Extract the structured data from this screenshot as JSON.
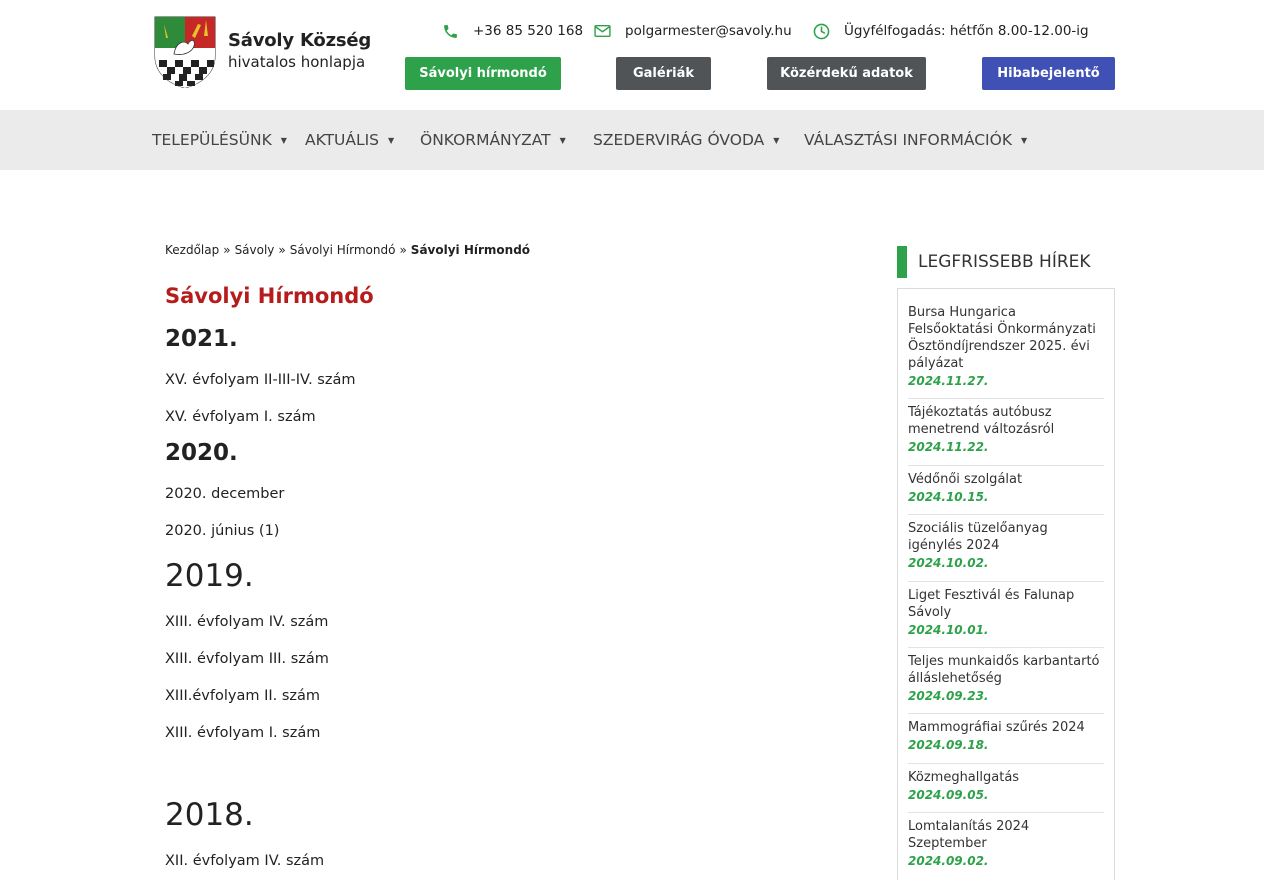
{
  "site": {
    "name": "Sávoly Község",
    "subtitle": "hivatalos honlapja"
  },
  "contact": {
    "phone": "+36 85 520 168",
    "email": "polgarmester@savoly.hu",
    "hours": "Ügyfélfogadás: hétfőn 8.00-12.00-ig"
  },
  "header_buttons": [
    {
      "label": "Sávolyi hírmondó",
      "color": "#2ea24a"
    },
    {
      "label": "Galériák",
      "color": "#515457"
    },
    {
      "label": "Közérdekű adatok",
      "color": "#515457"
    },
    {
      "label": "Hibabejelentő",
      "color": "#3f51b5"
    }
  ],
  "nav": [
    {
      "label": "TELEPÜLÉSÜNK"
    },
    {
      "label": "AKTUÁLIS"
    },
    {
      "label": "ÖNKORMÁNYZAT"
    },
    {
      "label": "SZEDERVIRÁG ÓVODA"
    },
    {
      "label": "VÁLASZTÁSI INFORMÁCIÓK"
    }
  ],
  "breadcrumb": {
    "items": [
      "Kezdőlap",
      "Sávoly",
      "Sávolyi Hírmondó"
    ],
    "current": "Sávolyi Hírmondó",
    "separator": "»"
  },
  "page": {
    "title": "Sávolyi Hírmondó",
    "sections": [
      {
        "year": "2021.",
        "issues": [
          "XV. évfolyam II-III-IV. szám",
          "XV. évfolyam I. szám"
        ]
      },
      {
        "year": "2020.",
        "issues": [
          "2020. december",
          "2020. június (1)"
        ]
      },
      {
        "year": "2019.",
        "issues": [
          "XIII. évfolyam IV. szám",
          "XIII. évfolyam III. szám",
          "XIII.évfolyam II. szám",
          "XIII. évfolyam I. szám"
        ]
      },
      {
        "year": "2018.",
        "issues": [
          "XII. évfolyam IV. szám"
        ]
      }
    ]
  },
  "sidebar": {
    "title": "LEGFRISSEBB HÍREK",
    "news": [
      {
        "title": "Bursa Hungarica Felsőoktatási Önkormányzati Ösztöndíjrendszer 2025. évi pályázat",
        "date": "2024.11.27."
      },
      {
        "title": "Tájékoztatás autóbusz menetrend változásról",
        "date": "2024.11.22."
      },
      {
        "title": "Védőnői szolgálat",
        "date": "2024.10.15."
      },
      {
        "title": "Szociális tüzelőanyag igénylés 2024",
        "date": "2024.10.02."
      },
      {
        "title": "Liget Fesztivál és Falunap Sávoly",
        "date": "2024.10.01."
      },
      {
        "title": "Teljes munkaidős karbantartó álláslehetőség",
        "date": "2024.09.23."
      },
      {
        "title": "Mammográfiai szűrés 2024",
        "date": "2024.09.18."
      },
      {
        "title": "Közmeghallgatás",
        "date": "2024.09.05."
      },
      {
        "title": "Lomtalanítás 2024 Szeptember",
        "date": "2024.09.02."
      }
    ]
  },
  "colors": {
    "accent_green": "#2ea24a",
    "title_red": "#b71c1c",
    "nav_bg": "#ebebeb",
    "button_gray": "#515457",
    "button_blue": "#3f51b5"
  }
}
